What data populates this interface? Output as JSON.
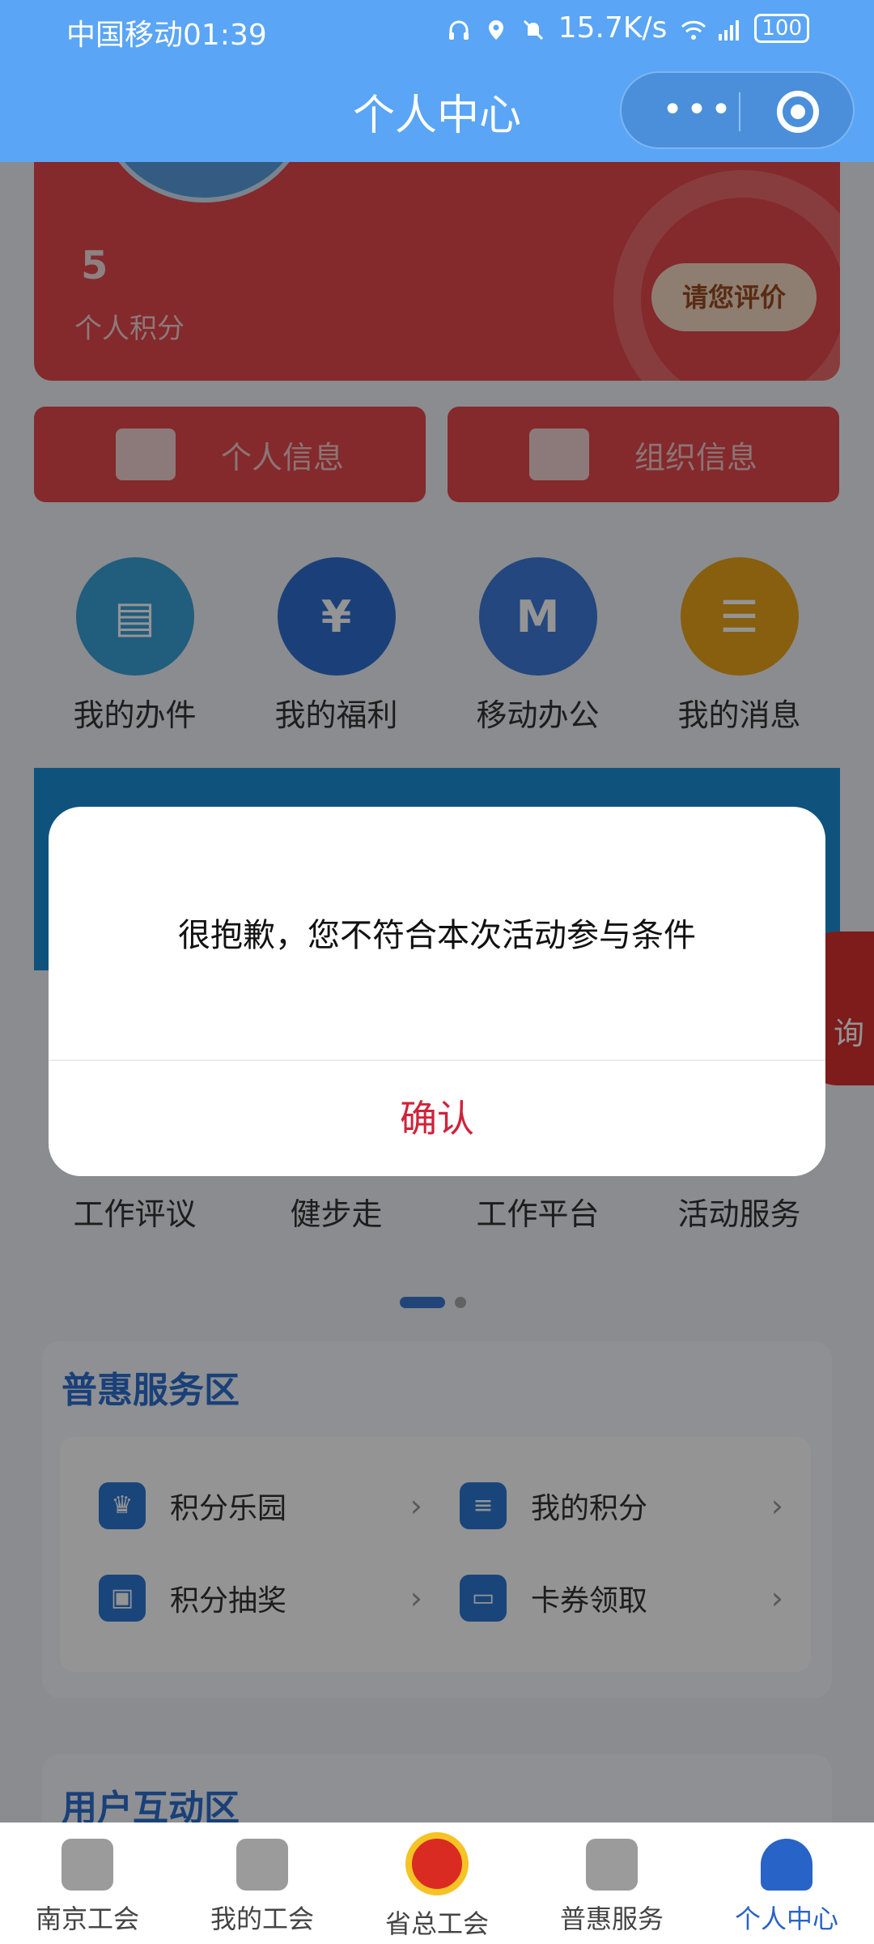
{
  "status_bar": {
    "carrier_time": "中国移动01:39",
    "speed": "15.7K/s",
    "battery": "100"
  },
  "nav": {
    "title": "个人中心",
    "more_icon": "more-dots-icon",
    "close_icon": "target-close-icon"
  },
  "profile": {
    "points_value": "5",
    "points_label": "个人积分",
    "rate_button": "请您评价"
  },
  "info_buttons": [
    {
      "label": "个人信息",
      "icon": "id-card-icon"
    },
    {
      "label": "组织信息",
      "icon": "org-chart-icon"
    }
  ],
  "apps_row1": [
    {
      "label": "我的办件",
      "icon": "document-icon",
      "color": "#3aa0d8"
    },
    {
      "label": "我的福利",
      "icon": "yen-shield-icon",
      "color": "#2f6fd1"
    },
    {
      "label": "移动办公",
      "icon": "m-logo-icon",
      "color": "#3d7ad9"
    },
    {
      "label": "我的消息",
      "icon": "chat-bubble-icon",
      "color": "#e9a41b"
    }
  ],
  "apps_row2": [
    {
      "label": "工作评议"
    },
    {
      "label": "健步走"
    },
    {
      "label": "工作平台"
    },
    {
      "label": "活动服务"
    }
  ],
  "consult_float": {
    "label": "询"
  },
  "benefit_zone": {
    "title": "普惠服务区",
    "items": [
      {
        "label": "积分乐园",
        "icon": "crown-icon"
      },
      {
        "label": "我的积分",
        "icon": "coins-icon"
      },
      {
        "label": "积分抽奖",
        "icon": "gift-icon"
      },
      {
        "label": "卡券领取",
        "icon": "coupon-icon"
      }
    ]
  },
  "interact_zone": {
    "title": "用户互动区"
  },
  "tabbar": [
    {
      "label": "南京工会",
      "icon": "home-icon"
    },
    {
      "label": "我的工会",
      "icon": "grid-icon"
    },
    {
      "label": "省总工会",
      "icon": "union-emblem-icon"
    },
    {
      "label": "普惠服务",
      "icon": "heart-icon"
    },
    {
      "label": "个人中心",
      "icon": "person-icon"
    }
  ],
  "dialog": {
    "message": "很抱歉，您不符合本次活动参与条件",
    "confirm": "确认",
    "confirm_color": "#d0233a"
  }
}
